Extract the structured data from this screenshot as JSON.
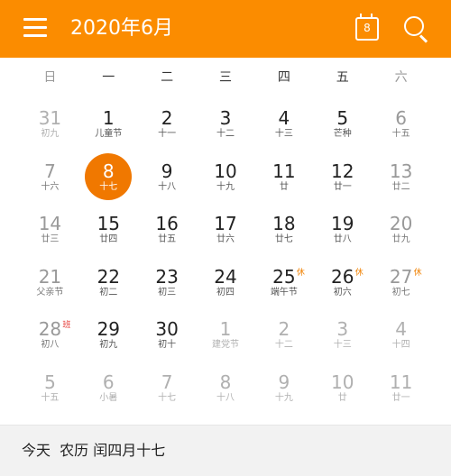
{
  "header": {
    "title": "2020年6月",
    "today_icon_number": "8",
    "accent_color": "#fb8c00"
  },
  "weekdays": [
    "日",
    "一",
    "二",
    "三",
    "四",
    "五",
    "六"
  ],
  "weeks": [
    [
      {
        "day": "31",
        "lunar": "初九",
        "faded": true
      },
      {
        "day": "1",
        "lunar": "儿童节"
      },
      {
        "day": "2",
        "lunar": "十一"
      },
      {
        "day": "3",
        "lunar": "十二"
      },
      {
        "day": "4",
        "lunar": "十三"
      },
      {
        "day": "5",
        "lunar": "芒种"
      },
      {
        "day": "6",
        "lunar": "十五"
      }
    ],
    [
      {
        "day": "7",
        "lunar": "十六"
      },
      {
        "day": "8",
        "lunar": "十七",
        "today": true
      },
      {
        "day": "9",
        "lunar": "十八"
      },
      {
        "day": "10",
        "lunar": "十九"
      },
      {
        "day": "11",
        "lunar": "廿"
      },
      {
        "day": "12",
        "lunar": "廿一"
      },
      {
        "day": "13",
        "lunar": "廿二"
      }
    ],
    [
      {
        "day": "14",
        "lunar": "廿三"
      },
      {
        "day": "15",
        "lunar": "廿四"
      },
      {
        "day": "16",
        "lunar": "廿五"
      },
      {
        "day": "17",
        "lunar": "廿六"
      },
      {
        "day": "18",
        "lunar": "廿七"
      },
      {
        "day": "19",
        "lunar": "廿八"
      },
      {
        "day": "20",
        "lunar": "廿九"
      }
    ],
    [
      {
        "day": "21",
        "lunar": "父亲节"
      },
      {
        "day": "22",
        "lunar": "初二"
      },
      {
        "day": "23",
        "lunar": "初三"
      },
      {
        "day": "24",
        "lunar": "初四"
      },
      {
        "day": "25",
        "lunar": "端午节",
        "tag": "休"
      },
      {
        "day": "26",
        "lunar": "初六",
        "tag": "休"
      },
      {
        "day": "27",
        "lunar": "初七",
        "tag": "休"
      }
    ],
    [
      {
        "day": "28",
        "lunar": "初八",
        "tag": "班",
        "tag_type": "work"
      },
      {
        "day": "29",
        "lunar": "初九"
      },
      {
        "day": "30",
        "lunar": "初十"
      },
      {
        "day": "1",
        "lunar": "建党节",
        "faded": true
      },
      {
        "day": "2",
        "lunar": "十二",
        "faded": true
      },
      {
        "day": "3",
        "lunar": "十三",
        "faded": true
      },
      {
        "day": "4",
        "lunar": "十四",
        "faded": true
      }
    ],
    [
      {
        "day": "5",
        "lunar": "十五",
        "faded": true
      },
      {
        "day": "6",
        "lunar": "小暑",
        "faded": true
      },
      {
        "day": "7",
        "lunar": "十七",
        "faded": true
      },
      {
        "day": "8",
        "lunar": "十八",
        "faded": true
      },
      {
        "day": "9",
        "lunar": "十九",
        "faded": true
      },
      {
        "day": "10",
        "lunar": "廿",
        "faded": true
      },
      {
        "day": "11",
        "lunar": "廿一",
        "faded": true
      }
    ]
  ],
  "footer": {
    "text": "今天  农历 闰四月十七"
  }
}
